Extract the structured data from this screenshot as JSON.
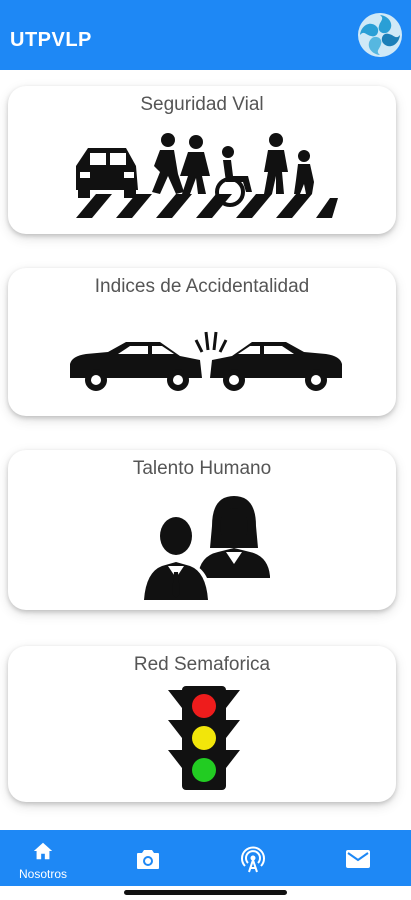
{
  "app": {
    "title": "UTPVLP",
    "logo_icon": "swirl-logo-icon",
    "accent": "#1e88f5"
  },
  "cards": [
    {
      "title": "Seguridad Vial",
      "icon": "pedestrian-crossing-icon"
    },
    {
      "title": "Indices de Accidentalidad",
      "icon": "car-collision-icon"
    },
    {
      "title": "Talento Humano",
      "icon": "people-icon"
    },
    {
      "title": "Red Semaforica",
      "icon": "traffic-light-icon"
    }
  ],
  "bottom_nav": {
    "items": [
      {
        "label": "Nosotros",
        "icon": "home-icon",
        "selected": true
      },
      {
        "label": "",
        "icon": "camera-icon"
      },
      {
        "label": "",
        "icon": "broadcast-icon"
      },
      {
        "label": "",
        "icon": "mail-icon"
      }
    ]
  }
}
